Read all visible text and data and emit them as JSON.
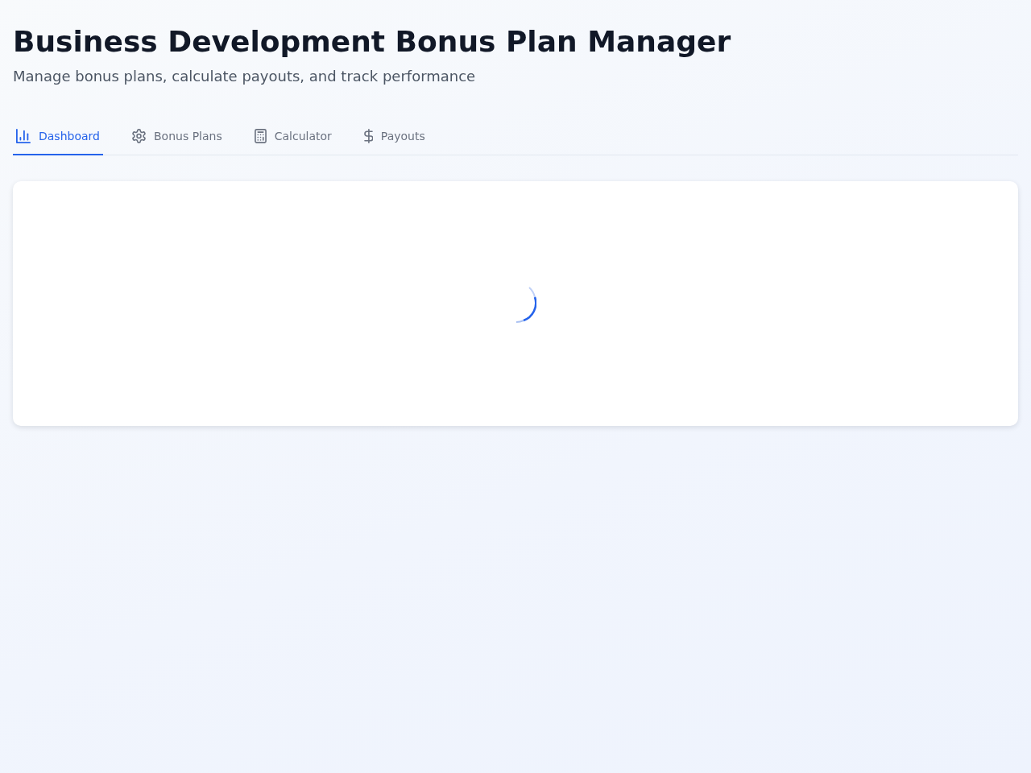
{
  "header": {
    "title": "Business Development Bonus Plan Manager",
    "subtitle": "Manage bonus plans, calculate payouts, and track performance"
  },
  "tabs": [
    {
      "label": "Dashboard",
      "selected": true
    },
    {
      "label": "Bonus Plans",
      "selected": false
    },
    {
      "label": "Calculator",
      "selected": false
    },
    {
      "label": "Payouts",
      "selected": false
    }
  ],
  "content": {
    "loading": true
  }
}
